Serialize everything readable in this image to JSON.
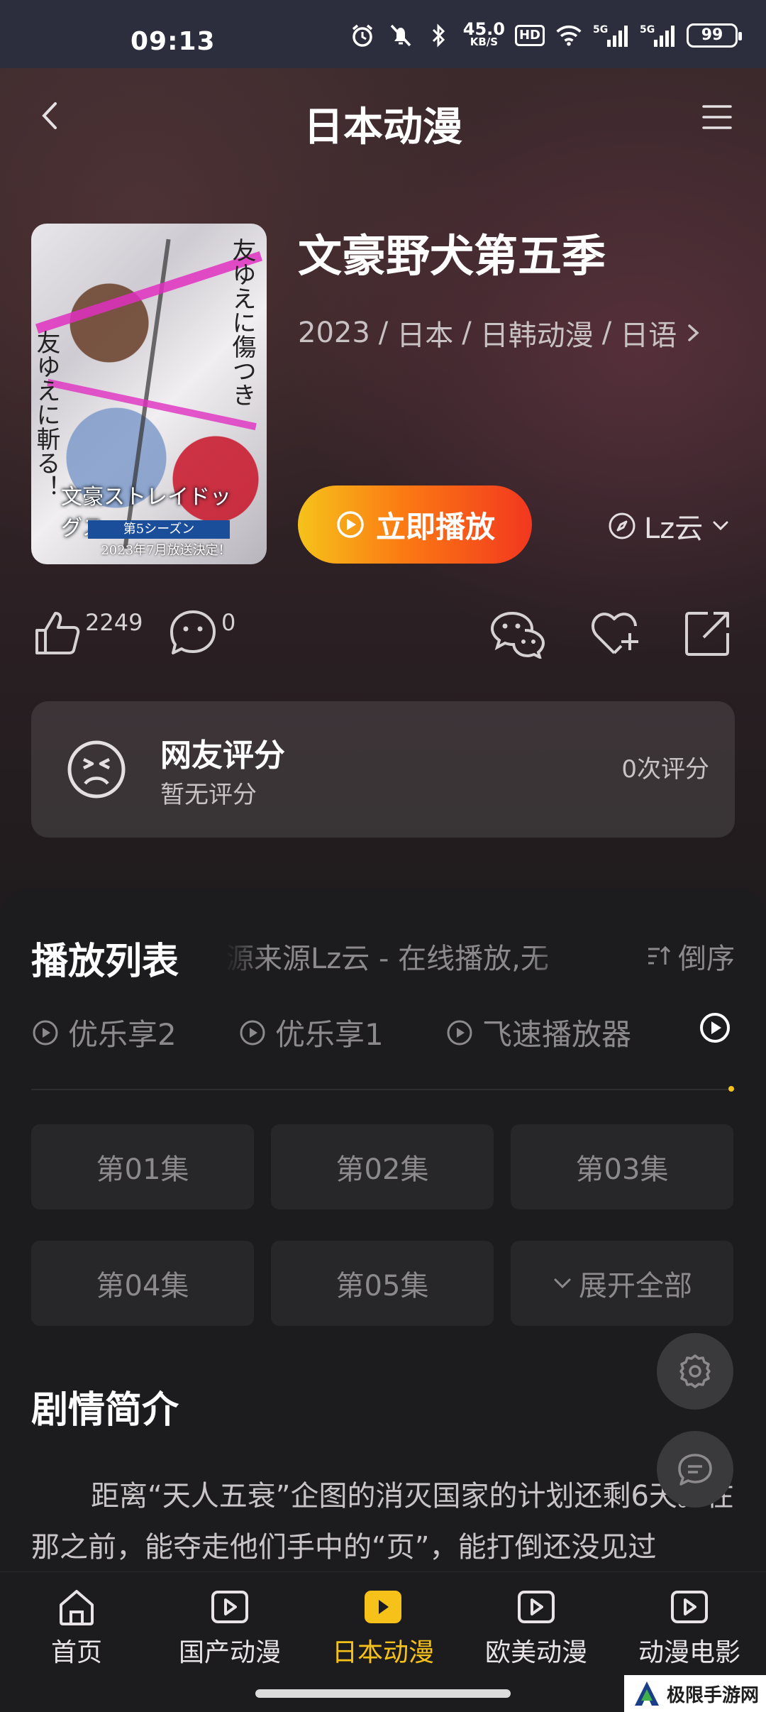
{
  "status_bar": {
    "time": "09:13",
    "speed_value": "45.0",
    "speed_unit": "KB/S",
    "hd_label": "HD",
    "net1": "5G",
    "net2": "5G",
    "battery": "99"
  },
  "header": {
    "title": "日本动漫"
  },
  "show": {
    "title": "文豪野犬第五季",
    "year": "2023",
    "region": "日本",
    "genre": "日韩动漫",
    "language": "日语",
    "separator": "/",
    "play_label": "立即播放",
    "source_label": "Lz云",
    "poster": {
      "vertical_text_right": "友ゆえに傷つき",
      "vertical_text_left": "友ゆえに斬る！",
      "logo_text": "文豪ストレイドッグス",
      "band_text": "第5シーズン",
      "date_text": "2023年7月放送決定！"
    }
  },
  "actions": {
    "likes": "2249",
    "comments": "0"
  },
  "rating": {
    "title": "网友评分",
    "subtitle": "暂无评分",
    "count": "0次评分"
  },
  "playlist": {
    "title": "播放列表",
    "marquee": "资源来源Lz云 - 在线播放,无",
    "sort_label": "倒序",
    "sources": [
      "优乐享2",
      "优乐享1",
      "飞速播放器"
    ],
    "episodes": [
      "第01集",
      "第02集",
      "第03集",
      "第04集",
      "第05集"
    ],
    "expand_label": "展开全部"
  },
  "synopsis": {
    "title": "剧情简介",
    "text": "距离“天人五衰”企图的消灭国家的计划还剩6天。在那之前，能夺走他们手中的“页”，能打倒还没见过"
  },
  "bottom_nav": {
    "items": [
      {
        "label": "首页",
        "icon": "home-icon"
      },
      {
        "label": "国产动漫",
        "icon": "play-square-icon"
      },
      {
        "label": "日本动漫",
        "icon": "play-square-icon"
      },
      {
        "label": "欧美动漫",
        "icon": "play-square-icon"
      },
      {
        "label": "动漫电影",
        "icon": "play-square-icon"
      }
    ],
    "active_index": 2
  },
  "watermark": {
    "text": "极限手游网"
  },
  "colors": {
    "accent": "#f6c21a",
    "play_gradient_start": "#f6c21a",
    "play_gradient_end": "#f2371f",
    "panel_bg": "#1c1b1d"
  }
}
